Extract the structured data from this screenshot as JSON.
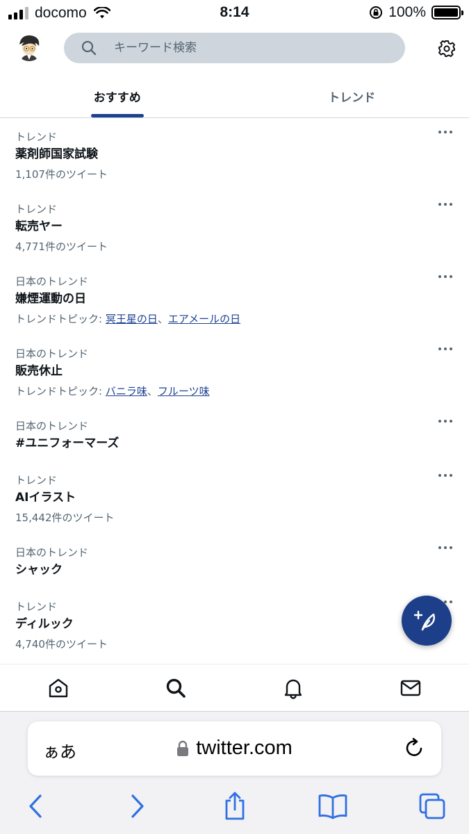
{
  "status_bar": {
    "carrier": "docomo",
    "time": "8:14",
    "battery": "100%"
  },
  "search": {
    "placeholder": "キーワード検索"
  },
  "tabs": [
    {
      "label": "おすすめ",
      "active": true
    },
    {
      "label": "トレンド",
      "active": false
    }
  ],
  "trends": [
    {
      "category": "トレンド",
      "name": "薬剤師国家試験",
      "meta": "1,107件のツイート"
    },
    {
      "category": "トレンド",
      "name": "転売ヤー",
      "meta": "4,771件のツイート"
    },
    {
      "category": "日本のトレンド",
      "name": "嫌煙運動の日",
      "topics_label": "トレンドトピック:",
      "topics": [
        "冥王星の日",
        "エアメールの日"
      ],
      "separator": "、"
    },
    {
      "category": "日本のトレンド",
      "name": "販売休止",
      "topics_label": "トレンドトピック:",
      "topics": [
        "バニラ味",
        "フルーツ味"
      ],
      "separator": "、"
    },
    {
      "category": "日本のトレンド",
      "name": "#ユニフォーマーズ"
    },
    {
      "category": "トレンド",
      "name": "AIイラスト",
      "meta": "15,442件のツイート"
    },
    {
      "category": "日本のトレンド",
      "name": "シャック"
    },
    {
      "category": "トレンド",
      "name": "ディルック",
      "meta": "4,740件のツイート"
    }
  ],
  "safari": {
    "text_size_label": "ぁあ",
    "url": "twitter.com"
  },
  "colors": {
    "accent": "#1d4291",
    "fab": "#1d3f8a",
    "secondary_text": "#536471"
  },
  "icons": {
    "bottom_nav": [
      "home-icon",
      "search-icon",
      "bell-icon",
      "mail-icon"
    ],
    "safari_tools": [
      "back-icon",
      "forward-icon",
      "share-icon",
      "bookmarks-icon",
      "tabs-icon"
    ]
  }
}
